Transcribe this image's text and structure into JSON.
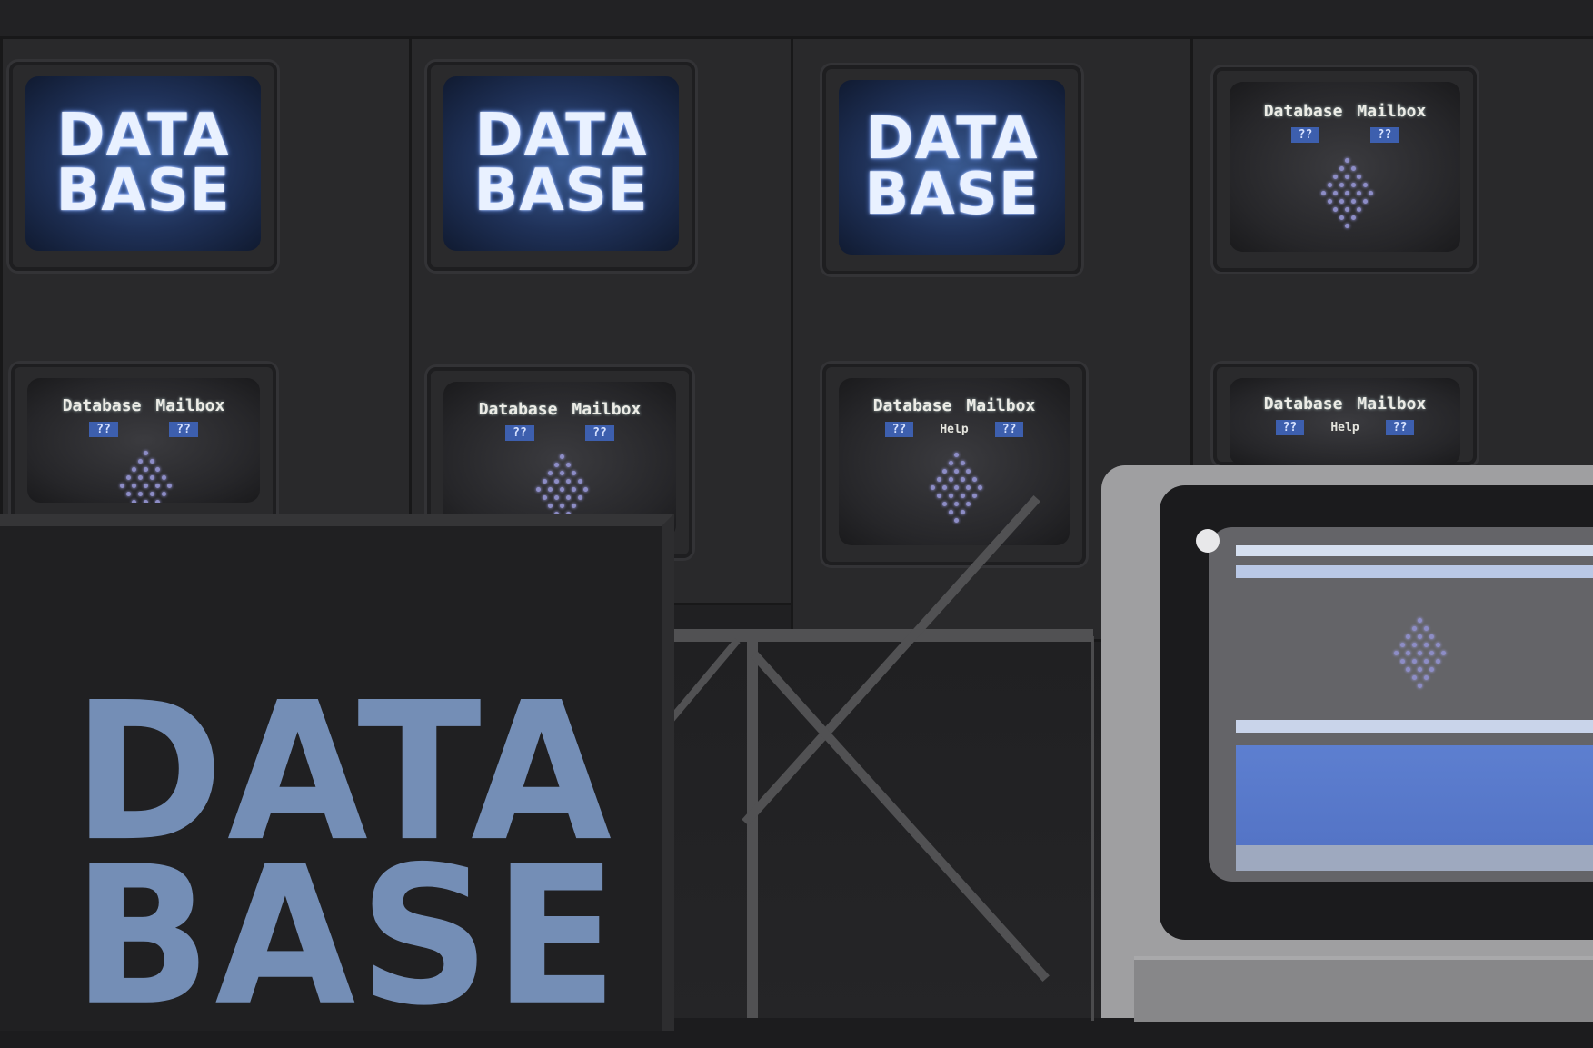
{
  "scene": {
    "description_tag": "studio set with wall of monitors",
    "colors": {
      "logo_glow": "#6f9cff",
      "screen_blue": "#3a5b93",
      "menu_tag": "#3d5fae",
      "tree_dot": "#8d8dc6",
      "computer_case": "#9f9fa1"
    }
  },
  "logo": {
    "line1": "DATA",
    "line2": "BASE"
  },
  "menu_screen": {
    "title_left": "Database",
    "title_right": "Mailbox",
    "tag_left": "??",
    "tag_mid": "Help",
    "tag_right": "??"
  },
  "big_logo": {
    "line1": "DATA",
    "line2": "BASE"
  }
}
